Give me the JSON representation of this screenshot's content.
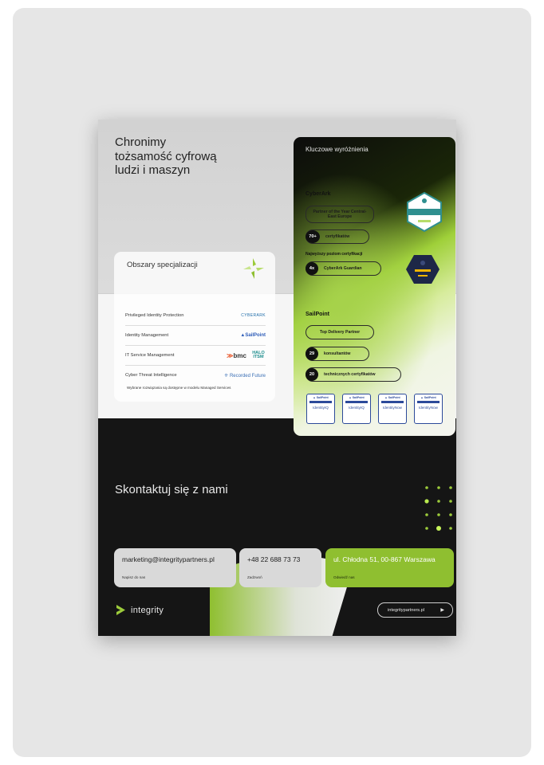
{
  "headline": "Chronimy tożsamość cyfrową ludzi i maszyn",
  "specializations": {
    "title": "Obszary specjalizacji",
    "items": [
      {
        "area": "Privileged Identity Protection",
        "vendor": "CYBERARK",
        "vendor_color": "#1b6aa8"
      },
      {
        "area": "Identity Management",
        "vendor": "SailPoint",
        "vendor_color": "#2d5cb8"
      },
      {
        "area": "IT Service Management",
        "vendor": "bmc",
        "vendor2": "HALO ITSM",
        "vendor_color": "#e8562a"
      },
      {
        "area": "Cyber Threat Intelligence",
        "vendor": "Recorded Future",
        "vendor_color": "#3a6fb5"
      }
    ],
    "note": "Wybrane rozwiązania są dostępne w modelu Managed Services"
  },
  "highlights": {
    "title": "Kluczowe wyróżnienia",
    "cyberark": {
      "heading": "CyberArk",
      "award": "Partner of the Year Central-East Europe",
      "certs_count": "70+",
      "certs_label": "certyfikatów",
      "highest_level": "Najwyższy poziom certyfikacji",
      "guardian_count": "4x",
      "guardian_label": "CyberArk Guardian"
    },
    "sailpoint": {
      "heading": "SailPoint",
      "award": "Top Delivery Partner",
      "consultants_count": "29",
      "consultants_label": "konsultantów",
      "tech_count": "20",
      "tech_label": "technicznych certyfikatów",
      "badges": [
        "IdentityIQ",
        "IdentityIQ",
        "IdentityNow",
        "IdentityNow"
      ]
    }
  },
  "contact": {
    "title": "Skontaktuj się z nami",
    "email": "marketing@integritypartners.pl",
    "email_label": "Napisz do nas",
    "phone": "+48 22 688 73 73",
    "phone_label": "Zadzwoń",
    "address": "ul. Chłodna 51, 00-867 Warszawa",
    "address_label": "Odwiedź nas",
    "brand": "integrity",
    "website": "integritypartners.pl"
  },
  "colors": {
    "accent_green": "#9ccb3b",
    "dark": "#151515"
  }
}
